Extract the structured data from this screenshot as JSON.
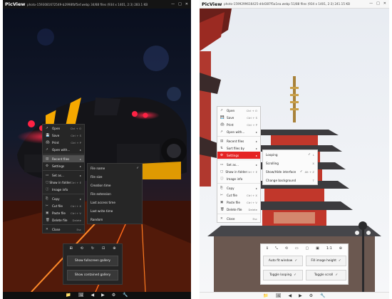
{
  "left": {
    "title": "PicView",
    "file_info": "photo-1593081672549-b2998fbf5ef.webp 34/88 files (934 x 1401, 2:3) 283.1 KB",
    "window_buttons": [
      "—",
      "□",
      "✕"
    ],
    "context_menu": [
      {
        "icon": "↗",
        "label": "Open",
        "shortcut": "Ctrl + O",
        "arrow": ""
      },
      {
        "icon": "💾",
        "label": "Save",
        "shortcut": "Ctrl + S",
        "arrow": ""
      },
      {
        "icon": "🖨",
        "label": "Print",
        "shortcut": "Ctrl + P",
        "arrow": ""
      },
      {
        "icon": "↗",
        "label": "Open with...",
        "shortcut": "",
        "arrow": "▸"
      },
      {
        "icon": "▤",
        "label": "Recent files",
        "shortcut": "",
        "arrow": "▸"
      },
      {
        "icon": "⚙",
        "label": "Settings",
        "shortcut": "",
        "arrow": "▸"
      },
      {
        "icon": "▭",
        "label": "Set as...",
        "shortcut": "",
        "arrow": "▸"
      },
      {
        "icon": "▢",
        "label": "Show in folder",
        "shortcut": "Ctrl + E",
        "arrow": ""
      },
      {
        "icon": "ⓘ",
        "label": "Image info",
        "shortcut": "",
        "arrow": ""
      },
      {
        "icon": "⎘",
        "label": "Copy",
        "shortcut": "",
        "arrow": "▸"
      },
      {
        "icon": "✂",
        "label": "Cut file",
        "shortcut": "Ctrl + X",
        "arrow": ""
      },
      {
        "icon": "▣",
        "label": "Paste file",
        "shortcut": "Ctrl + V",
        "arrow": ""
      },
      {
        "icon": "🗑",
        "label": "Delete file",
        "shortcut": "Delete",
        "arrow": ""
      },
      {
        "icon": "✕",
        "label": "Close",
        "shortcut": "Esc",
        "arrow": ""
      }
    ],
    "sort_submenu": [
      {
        "label": "File name",
        "checked": true
      },
      {
        "label": "File size",
        "checked": false
      },
      {
        "label": "Creation time",
        "checked": false
      },
      {
        "label": "File extension",
        "checked": false
      },
      {
        "label": "Last access time",
        "checked": false
      },
      {
        "label": "Last write time",
        "checked": false
      },
      {
        "label": "Random",
        "checked": false
      }
    ],
    "toolbox_icons": [
      "⊞",
      "⟲",
      "↻",
      "⊡",
      "⊕"
    ],
    "gallery_buttons": [
      "Show fullscreen gallery",
      "Show contained gallery"
    ],
    "bottom_icons": [
      "📁",
      "🖼",
      "◀",
      "▶",
      "⚙",
      "🔧"
    ]
  },
  "right": {
    "title": "PicView",
    "file_info": "photo-1599299616425-d4d387f5a1ea.webp 51/88 files (934 x 1401, 2:3) 241.15 KB",
    "window_buttons": [
      "—",
      "□",
      "✕"
    ],
    "context_menu": [
      {
        "icon": "↗",
        "label": "Open",
        "shortcut": "Ctrl + O",
        "arrow": ""
      },
      {
        "icon": "💾",
        "label": "Save",
        "shortcut": "Ctrl + S",
        "arrow": ""
      },
      {
        "icon": "🖨",
        "label": "Print",
        "shortcut": "Ctrl + P",
        "arrow": ""
      },
      {
        "icon": "↗",
        "label": "Open with...",
        "shortcut": "",
        "arrow": "▸"
      },
      {
        "icon": "▤",
        "label": "Recent files",
        "shortcut": "",
        "arrow": "▸"
      },
      {
        "icon": "⇅",
        "label": "Sort files by",
        "shortcut": "",
        "arrow": "▸"
      },
      {
        "icon": "⚙",
        "label": "Settings",
        "shortcut": "",
        "arrow": "▸"
      },
      {
        "icon": "▭",
        "label": "Set as...",
        "shortcut": "",
        "arrow": "▸"
      },
      {
        "icon": "▢",
        "label": "Show in folder",
        "shortcut": "Ctrl + E",
        "arrow": ""
      },
      {
        "icon": "ⓘ",
        "label": "Image info",
        "shortcut": "",
        "arrow": ""
      },
      {
        "icon": "⎘",
        "label": "Copy",
        "shortcut": "",
        "arrow": "▸"
      },
      {
        "icon": "✂",
        "label": "Cut file",
        "shortcut": "Ctrl + X",
        "arrow": ""
      },
      {
        "icon": "▣",
        "label": "Paste file",
        "shortcut": "Ctrl + V",
        "arrow": ""
      },
      {
        "icon": "🗑",
        "label": "Delete file",
        "shortcut": "Delete",
        "arrow": ""
      },
      {
        "icon": "✕",
        "label": "Close",
        "shortcut": "Esc",
        "arrow": ""
      }
    ],
    "settings_submenu": [
      {
        "label": "Looping",
        "check": "✓",
        "shortcut": "L"
      },
      {
        "label": "Scrolling",
        "check": "",
        "shortcut": "X"
      },
      {
        "label": "Show/Hide interface",
        "check": "✓",
        "shortcut": "Alt + Z"
      },
      {
        "label": "Change background",
        "check": "",
        "shortcut": "T"
      }
    ],
    "toolbox_icons": [
      "ℹ",
      "⤡",
      "⟲",
      "▭",
      "▢",
      "▣",
      "1:1",
      "⊕"
    ],
    "option_buttons": [
      {
        "label": "Auto fit window",
        "checked": true
      },
      {
        "label": "Fill image height",
        "checked": true
      },
      {
        "label": "Toggle looping",
        "checked": true
      },
      {
        "label": "Toggle scroll",
        "checked": true
      }
    ],
    "bottom_icons": [
      "📁",
      "🖼",
      "◀",
      "▶",
      "⚙",
      "🔧"
    ]
  },
  "colors": {
    "highlight_red": "#e52424",
    "dark_menu_bg": "#262626",
    "light_menu_bg": "#fbfbfb"
  }
}
